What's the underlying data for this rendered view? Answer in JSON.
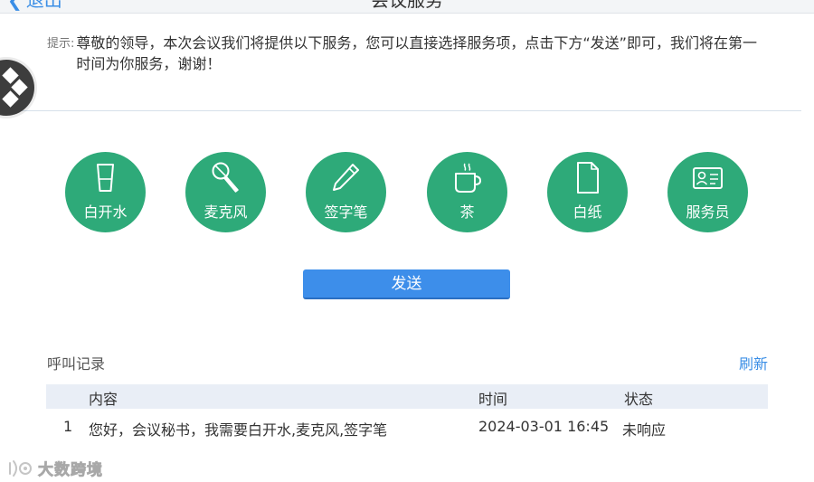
{
  "header": {
    "back_label": "退出",
    "title": "会议服务"
  },
  "notice": {
    "label": "提示:",
    "text": "尊敬的领导，本次会议我们将提供以下服务，您可以直接选择服务项，点击下方“发送”即可，我们将在第一时间为你服务，谢谢！"
  },
  "services": [
    {
      "label": "白开水",
      "icon": "water-glass-icon"
    },
    {
      "label": "麦克风",
      "icon": "microphone-icon"
    },
    {
      "label": "签字笔",
      "icon": "pen-icon"
    },
    {
      "label": "茶",
      "icon": "tea-cup-icon"
    },
    {
      "label": "白纸",
      "icon": "paper-icon"
    },
    {
      "label": "服务员",
      "icon": "staff-card-icon"
    }
  ],
  "colors": {
    "service_green": "#2eaa79",
    "accent_blue": "#3d8eea"
  },
  "send_label": "发送",
  "records": {
    "title": "呼叫记录",
    "refresh_label": "刷新",
    "columns": {
      "content": "内容",
      "time": "时间",
      "status": "状态"
    },
    "rows": [
      {
        "index": "1",
        "content": "您好，会议秘书，我需要白开水,麦克风,签字笔",
        "time": "2024-03-01 16:45",
        "status": "未响应"
      }
    ]
  },
  "watermark": {
    "text": "大数跨境"
  }
}
